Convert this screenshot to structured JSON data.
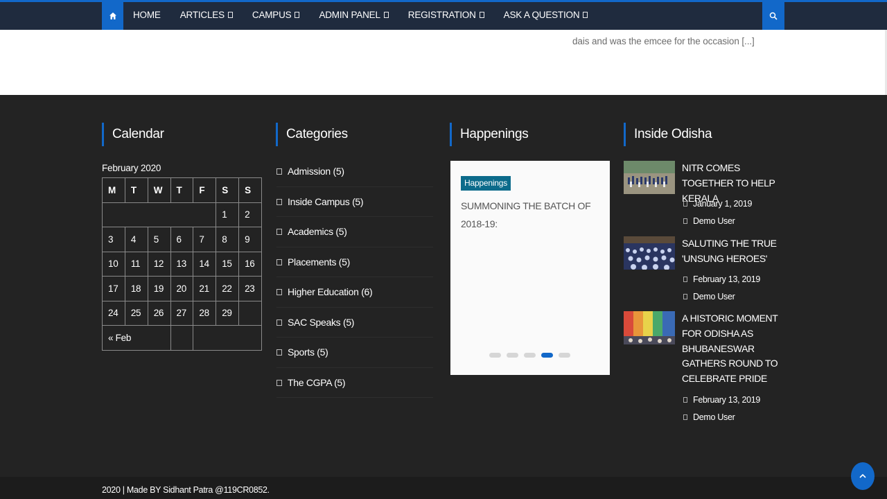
{
  "nav": {
    "home_icon": "home-icon",
    "items": [
      {
        "label": "HOME",
        "has_caret": false
      },
      {
        "label": "ARTICLES",
        "has_caret": true
      },
      {
        "label": "CAMPUS",
        "has_caret": true
      },
      {
        "label": "ADMIN PANEL",
        "has_caret": true
      },
      {
        "label": "REGISTRATION",
        "has_caret": true
      },
      {
        "label": "ASK A QUESTION",
        "has_caret": true
      }
    ],
    "search_icon": "search-icon",
    "accent_color": "#1268c9",
    "background_color": "#1f2b3e"
  },
  "excerpt": {
    "text": "dais and was the emcee for the occasion [...]"
  },
  "widgets": {
    "calendar_title": "Calendar",
    "categories_title": "Categories",
    "happenings_title": "Happenings",
    "odisha_title": "Inside Odisha"
  },
  "calendar": {
    "caption": "February 2020",
    "weekdays": [
      "M",
      "T",
      "W",
      "T",
      "F",
      "S",
      "S"
    ],
    "rows": [
      [
        "",
        "",
        "",
        "",
        "",
        "1",
        "2"
      ],
      [
        "3",
        "4",
        "5",
        "6",
        "7",
        "8",
        "9"
      ],
      [
        "10",
        "11",
        "12",
        "13",
        "14",
        "15",
        "16"
      ],
      [
        "17",
        "18",
        "19",
        "20",
        "21",
        "22",
        "23"
      ],
      [
        "24",
        "25",
        "26",
        "27",
        "28",
        "29",
        ""
      ]
    ],
    "prev_link": "« Feb"
  },
  "categories": [
    {
      "label": "Admission (5)"
    },
    {
      "label": "Inside Campus (5)"
    },
    {
      "label": "Academics (5)"
    },
    {
      "label": "Placements (5)"
    },
    {
      "label": "Higher Education (6)"
    },
    {
      "label": "SAC Speaks (5)"
    },
    {
      "label": "Sports (5)"
    },
    {
      "label": "The CGPA (5)"
    }
  ],
  "happenings": {
    "badge": "Happenings",
    "title": "SUMMONING THE BATCH OF 2018-19:",
    "slide_count": 5,
    "active_slide": 4,
    "badge_color": "#0c6b8b"
  },
  "odisha_posts": [
    {
      "title": "NITR COMES TOGETHER TO HELP KERALA",
      "date": "January 1, 2019",
      "author": "Demo User",
      "thumb": "crowd-ground-photo"
    },
    {
      "title": "SALUTING THE TRUE 'UNSUNG HEROES'",
      "date": "February 13, 2019",
      "author": "Demo User",
      "thumb": "auditorium-audience-photo"
    },
    {
      "title": "A HISTORIC MOMENT FOR ODISHA AS BHUBANESWAR GATHERS ROUND TO CELEBRATE PRIDE",
      "date": "February 13, 2019",
      "author": "Demo User",
      "thumb": "pride-flag-photo"
    }
  ],
  "footer": {
    "copyright": "2020 | Made BY Sidhant Patra @119CR0852."
  },
  "back_to_top_icon": "arrow-up-icon"
}
